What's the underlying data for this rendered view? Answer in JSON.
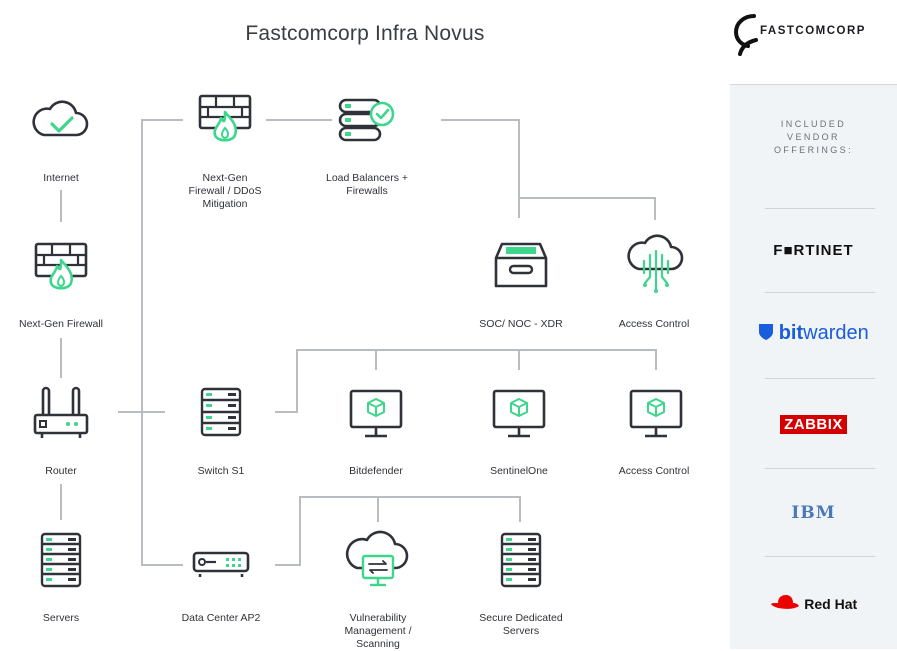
{
  "title": "Fastcomcorp Infra Novus",
  "nodes": {
    "internet": "Internet",
    "ngfw_left": "Next-Gen Firewall",
    "router": "Router",
    "servers": "Servers",
    "ngfw_ddos": "Next-Gen\nFirewall / DDoS\nMitigation",
    "load_balancers": "Load Balancers +\nFirewalls",
    "soc_noc": "SOC/ NOC - XDR",
    "access_control_cloud": "Access Control",
    "switch": "Switch S1",
    "bitdefender": "Bitdefender",
    "sentinelone": "SentinelOne",
    "access_control_monitor": "Access Control",
    "datacenter": "Data Center AP2",
    "vuln": "Vulnerability\nManagement /\nScanning",
    "secure_servers": "Secure Dedicated\nServers"
  },
  "sidebar": {
    "brand": "FASTCOMCORP",
    "included": "INCLUDED\nVENDOR\nOFFERINGS:",
    "vendors": {
      "fortinet": "F■RTINET",
      "bitwarden_bold": "bit",
      "bitwarden_rest": "warden",
      "zabbix": "ZABBIX",
      "ibm": "IBM",
      "redhat": "Red Hat"
    }
  },
  "colors": {
    "accent_green": "#3dd68c",
    "line_gray": "#b9bcc0",
    "icon_dark": "#2f3238",
    "fortinet_red": "#ee3124",
    "bitwarden_blue": "#175ddc",
    "zabbix_red": "#d40000",
    "ibm_blue": "#4d78b8",
    "redhat_red": "#ee0000"
  }
}
